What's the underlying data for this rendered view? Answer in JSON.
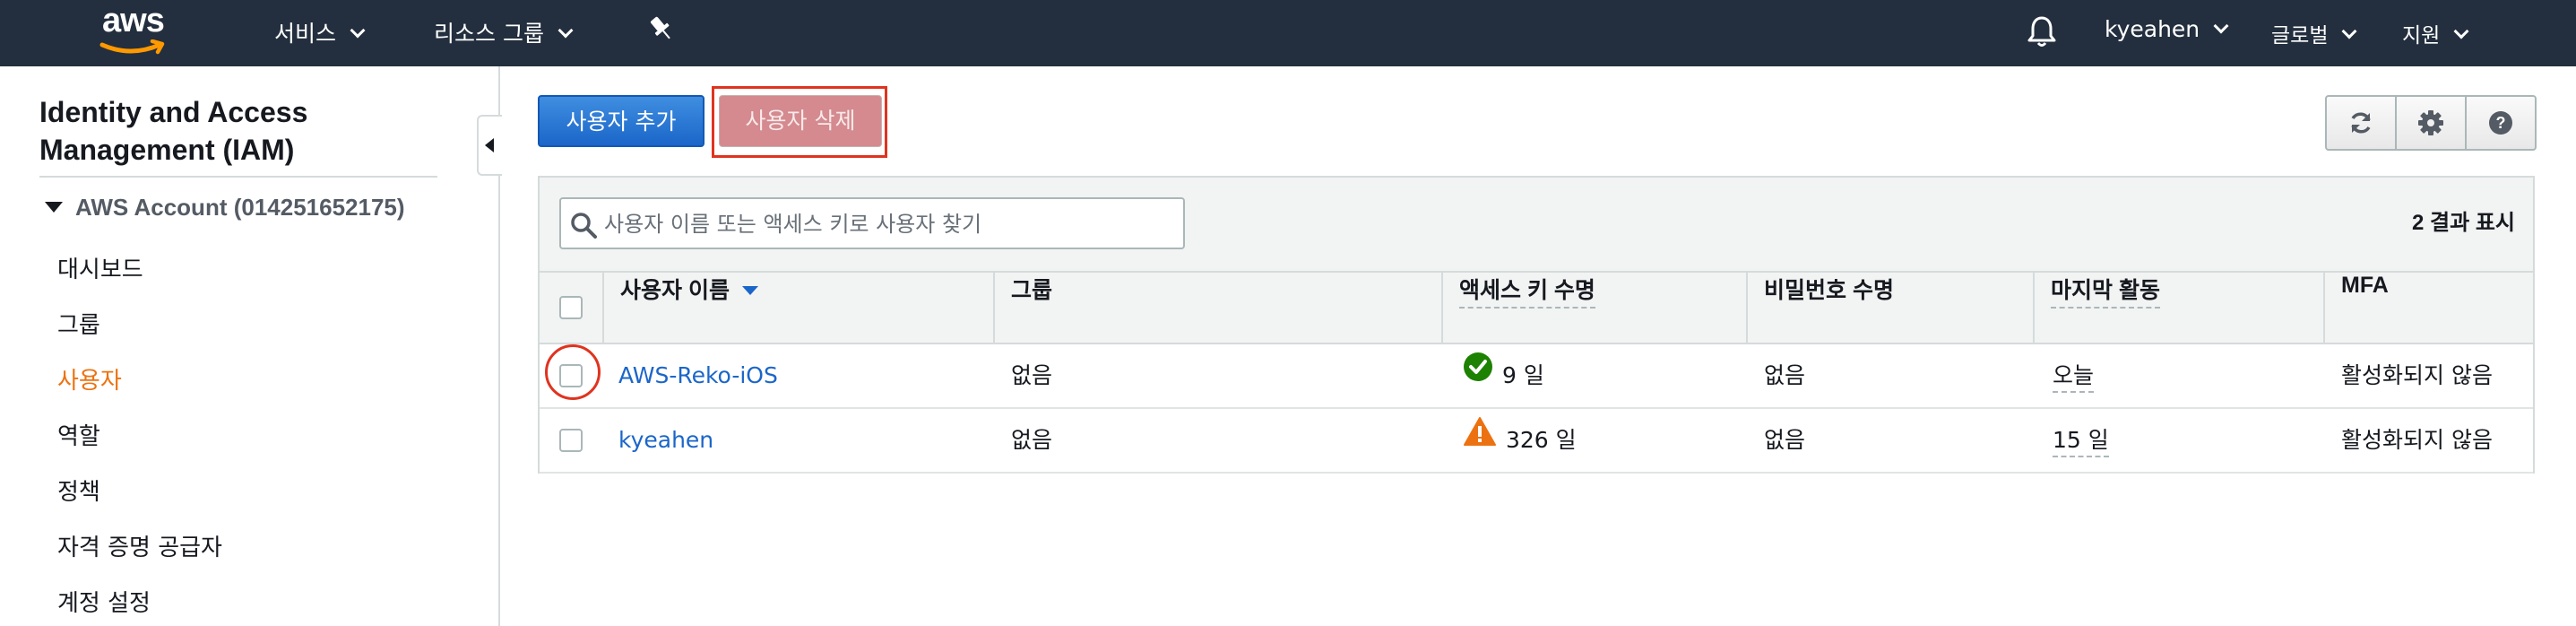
{
  "topnav": {
    "logo_text": "aws",
    "services_label": "서비스",
    "resource_groups_label": "리소스 그룹",
    "account_name": "kyeahen",
    "region_label": "글로벌",
    "support_label": "지원",
    "icons": [
      "pin-icon",
      "bell-icon",
      "chevron-down-icon"
    ]
  },
  "sidebar": {
    "title": "Identity and Access Management (IAM)",
    "account_label": "AWS Account (014251652175)",
    "items": [
      {
        "label": "대시보드",
        "active": false
      },
      {
        "label": "그룹",
        "active": false
      },
      {
        "label": "사용자",
        "active": true
      },
      {
        "label": "역할",
        "active": false
      },
      {
        "label": "정책",
        "active": false
      },
      {
        "label": "자격 증명 공급자",
        "active": false
      },
      {
        "label": "계정 설정",
        "active": false
      }
    ],
    "active_color": "#ec7211"
  },
  "toolbar": {
    "add_user_label": "사용자 추가",
    "delete_user_label": "사용자 삭제",
    "icons": [
      "refresh-icon",
      "gear-icon",
      "help-icon"
    ]
  },
  "search": {
    "placeholder": "사용자 이름 또는 액세스 키로 사용자 찾기",
    "value": ""
  },
  "results": {
    "count_label": "2 결과 표시"
  },
  "table": {
    "columns": {
      "username": "사용자 이름",
      "group": "그룹",
      "access_key_age": "액세스 키 수명",
      "password_age": "비밀번호 수명",
      "last_activity": "마지막 활동",
      "mfa": "MFA"
    },
    "rows": [
      {
        "username": "AWS-Reko-iOS",
        "group": "없음",
        "access_key_age": "9 일",
        "access_key_status": "ok",
        "password_age": "없음",
        "last_activity": "오늘",
        "mfa": "활성화되지 않음"
      },
      {
        "username": "kyeahen",
        "group": "없음",
        "access_key_age": "326 일",
        "access_key_status": "warning",
        "password_age": "없음",
        "last_activity": "15 일",
        "mfa": "활성화되지 않음"
      }
    ]
  },
  "colors": {
    "nav_bg": "#232f3e",
    "primary_button": "#1b66c9",
    "link": "#1b66c9",
    "ok": "#1d8102",
    "warning": "#ec7211",
    "highlight": "#e0331f"
  }
}
